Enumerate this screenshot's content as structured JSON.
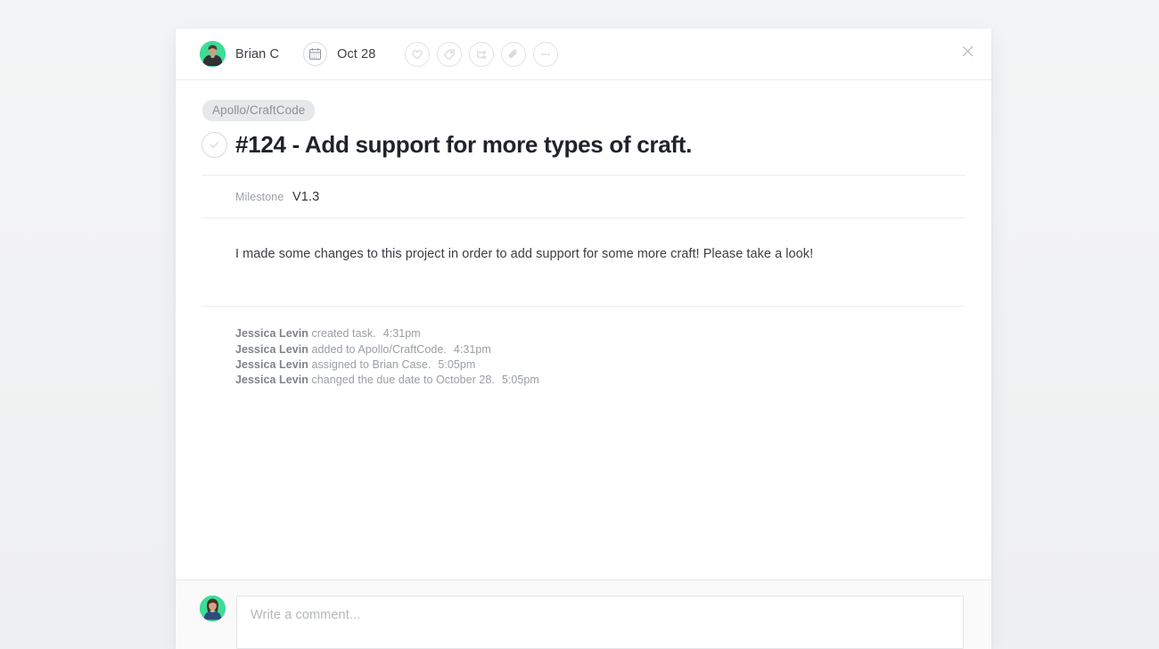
{
  "header": {
    "assignee_name": "Brian C",
    "assignee_avatar": "person-avatar",
    "calendar_icon": "calendar-icon",
    "due_date": "Oct 28",
    "actions": [
      {
        "name": "like-icon",
        "label": "Like"
      },
      {
        "name": "tag-icon",
        "label": "Tag"
      },
      {
        "name": "subtask-icon",
        "label": "Subtask"
      },
      {
        "name": "attachment-icon",
        "label": "Attach"
      },
      {
        "name": "more-options-icon",
        "label": "More"
      }
    ],
    "close_label": "×"
  },
  "task": {
    "project": "Apollo/CraftCode",
    "title": "#124 - Add support for more types of craft.",
    "complete_icon": "check-icon",
    "milestone_label": "Milestone",
    "milestone_value": "V1.3",
    "description": "I made some changes to this project in order to add support for some more craft! Please take a look!"
  },
  "activity": [
    {
      "actor": "Jessica Levin",
      "action": "created task.",
      "time": "4:31pm"
    },
    {
      "actor": "Jessica Levin",
      "action": "added to Apollo/CraftCode.",
      "time": "4:31pm"
    },
    {
      "actor": "Jessica Levin",
      "action": "assigned to Brian Case.",
      "time": "5:05pm"
    },
    {
      "actor": "Jessica Levin",
      "action": "changed the due date to October 28.",
      "time": "5:05pm"
    }
  ],
  "footer": {
    "commenter_avatar": "person-avatar",
    "comment_placeholder": "Write a comment...",
    "comment_value": ""
  },
  "colors": {
    "page_background": "#f1f2f3",
    "modal_background": "#ffffff",
    "avatar_background": "#3ddc97",
    "pill_background": "#e7e8ea",
    "title_text": "#20232a",
    "muted_text": "#9a9ea3",
    "border": "#ededed"
  }
}
